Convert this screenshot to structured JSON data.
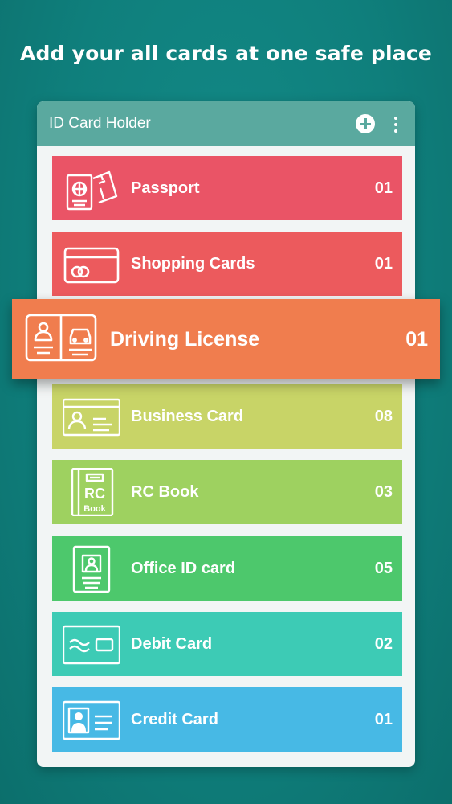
{
  "headline": "Add your all cards at one safe place",
  "app": {
    "title": "ID Card Holder",
    "add_icon": "plus-circle-icon",
    "more_icon": "more-vertical-icon"
  },
  "cards": [
    {
      "label": "Passport",
      "count": "01",
      "color": "#ea5466",
      "icon": "passport-icon"
    },
    {
      "label": "Shopping Cards",
      "count": "01",
      "color": "#ec5a5d",
      "icon": "shopping-card-icon"
    },
    {
      "label": "Driving License",
      "count": "01",
      "color": "#f07d4e",
      "icon": "driving-license-icon"
    },
    {
      "label": "Business Card",
      "count": "08",
      "color": "#c8d467",
      "icon": "business-card-icon"
    },
    {
      "label": "RC Book",
      "count": "03",
      "color": "#9ed160",
      "icon": "rc-book-icon"
    },
    {
      "label": "Office ID card",
      "count": "05",
      "color": "#4dc86c",
      "icon": "office-id-icon"
    },
    {
      "label": "Debit Card",
      "count": "02",
      "color": "#3dcbb5",
      "icon": "debit-card-icon"
    },
    {
      "label": "Credit Card",
      "count": "01",
      "color": "#47b9e5",
      "icon": "credit-card-icon"
    }
  ],
  "rc_icon_text": {
    "top": "RC",
    "bottom": "Book"
  }
}
